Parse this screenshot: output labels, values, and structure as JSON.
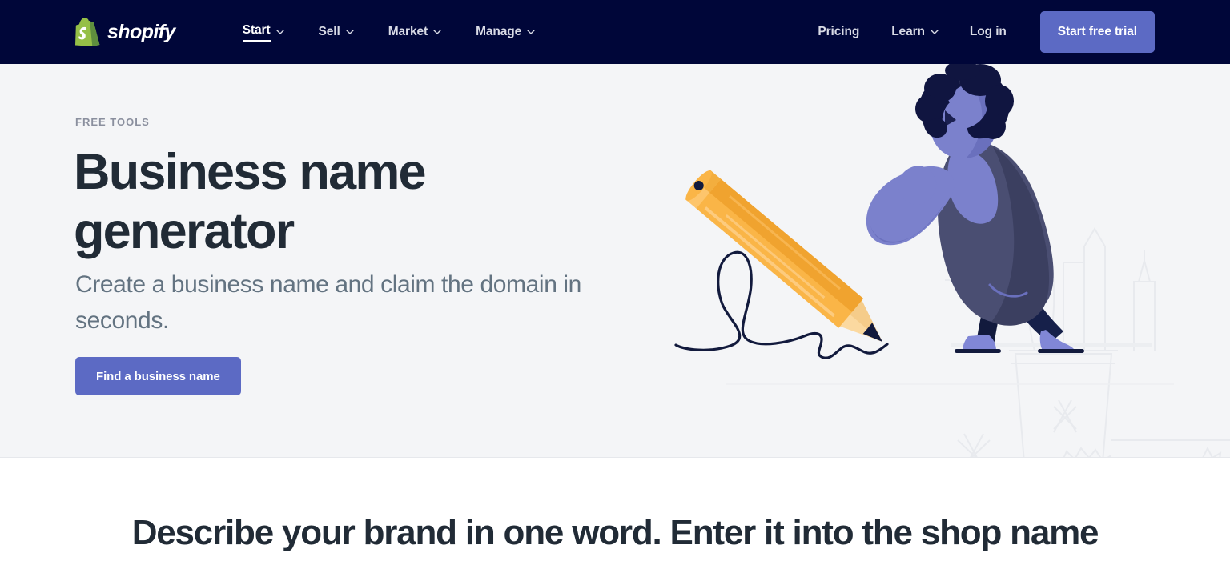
{
  "navbar": {
    "logo": {
      "icon": "shopify-bag-icon",
      "wordmark": "shopify"
    },
    "left_links": [
      {
        "label": "Start",
        "icon": "chevron-down-icon",
        "active": true
      },
      {
        "label": "Sell",
        "icon": "chevron-down-icon",
        "active": false
      },
      {
        "label": "Market",
        "icon": "chevron-down-icon",
        "active": false
      },
      {
        "label": "Manage",
        "icon": "chevron-down-icon",
        "active": false
      }
    ],
    "right_links": [
      {
        "label": "Pricing",
        "has_chevron": false
      },
      {
        "label": "Learn",
        "has_chevron": true
      },
      {
        "label": "Log in",
        "has_chevron": false
      }
    ],
    "cta_label": "Start free trial",
    "bg_color": "#000639",
    "cta_color": "#5c6ac4"
  },
  "hero": {
    "eyebrow": "FREE TOOLS",
    "title": "Business name generator",
    "subtitle": "Create a business name and claim the domain in seconds.",
    "cta_label": "Find a business name",
    "bg_color": "#f4f5f7",
    "title_color": "#212b36",
    "subtitle_color": "#637381",
    "cta_color": "#5c6ac4",
    "illustration": {
      "name": "person-drawing-with-giant-pencil-illustration",
      "pencil_body": "#fab547",
      "pencil_shade": "#f0a32f",
      "pencil_highlight": "#fdc56c",
      "pencil_wood": "#fbd9a0",
      "pencil_tip": "#0f1churchless",
      "skin": "#7b81cc",
      "skin_shadow": "#6a70bd",
      "hair": "#101540",
      "coat": "#4a4e72",
      "coat_dark": "#3b3f60",
      "shirt": "#7b81cc",
      "legs": "#121a3d",
      "shoes": "#8187d6",
      "squiggle": "#121a3d",
      "backdrop_line": "#e6e8ec"
    }
  },
  "section2": {
    "heading": "Describe your brand in one word. Enter it into the shop name"
  }
}
